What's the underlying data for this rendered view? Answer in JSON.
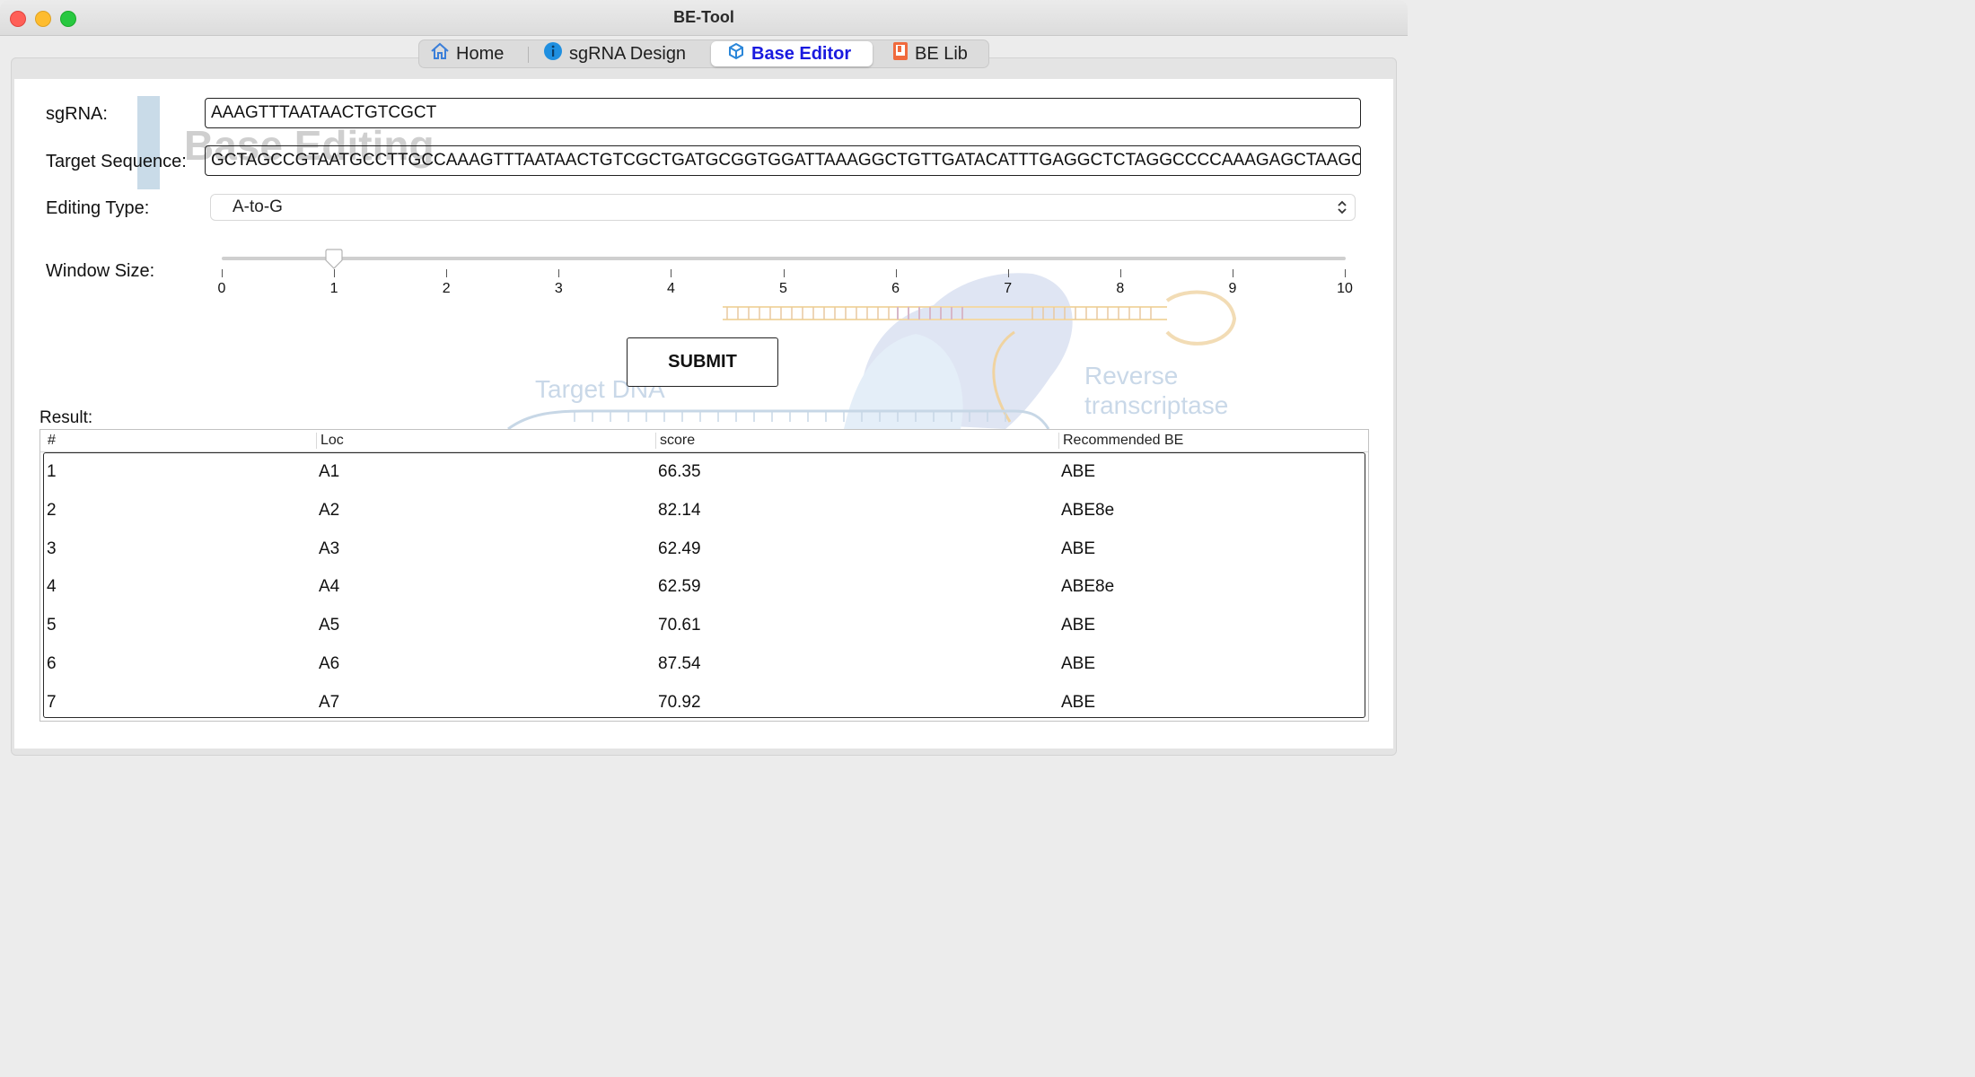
{
  "window": {
    "title": "BE-Tool"
  },
  "tabs": [
    {
      "label": "Home",
      "icon": "home-icon"
    },
    {
      "label": "sgRNA Design",
      "icon": "info-icon"
    },
    {
      "label": "Base Editor",
      "icon": "cube-icon",
      "selected": true
    },
    {
      "label": "BE Lib",
      "icon": "book-icon"
    }
  ],
  "form": {
    "sgrna_label": "sgRNA:",
    "sgrna_value": "AAAGTTTAATAACTGTCGCT",
    "target_label": "Target Sequence:",
    "target_value": "GCTAGCCGTAATGCCTTGCCAAAGTTTAATAACTGTCGCTGATGCGGTGGATTAAAGGCTGTTGATACATTTGAGGCTCTAGGCCCCAAAGAGCTAAGCG",
    "editing_type_label": "Editing Type:",
    "editing_type_value": "A-to-G",
    "window_size_label": "Window Size:",
    "window_size_value": 1,
    "window_size_ticks": [
      "0",
      "1",
      "2",
      "3",
      "4",
      "5",
      "6",
      "7",
      "8",
      "9",
      "10"
    ],
    "submit_label": "SUBMIT"
  },
  "background": {
    "base_editing": "Base Editing",
    "target_dna": "Target DNA",
    "reverse": "Reverse",
    "transcriptase": "transcriptase"
  },
  "result": {
    "label": "Result:",
    "columns": [
      "#",
      "Loc",
      "score",
      "Recommended BE"
    ],
    "rows": [
      [
        "1",
        "A1",
        "66.35",
        "ABE"
      ],
      [
        "2",
        "A2",
        "82.14",
        "ABE8e"
      ],
      [
        "3",
        "A3",
        "62.49",
        "ABE"
      ],
      [
        "4",
        "A4",
        "62.59",
        "ABE8e"
      ],
      [
        "5",
        "A5",
        "70.61",
        "ABE"
      ],
      [
        "6",
        "A6",
        "87.54",
        "ABE"
      ],
      [
        "7",
        "A7",
        "70.92",
        "ABE"
      ]
    ]
  },
  "colors": {
    "accent": "#1a1adf",
    "close": "#ff5f57",
    "minimize": "#febc2e",
    "maximize": "#28c840"
  }
}
